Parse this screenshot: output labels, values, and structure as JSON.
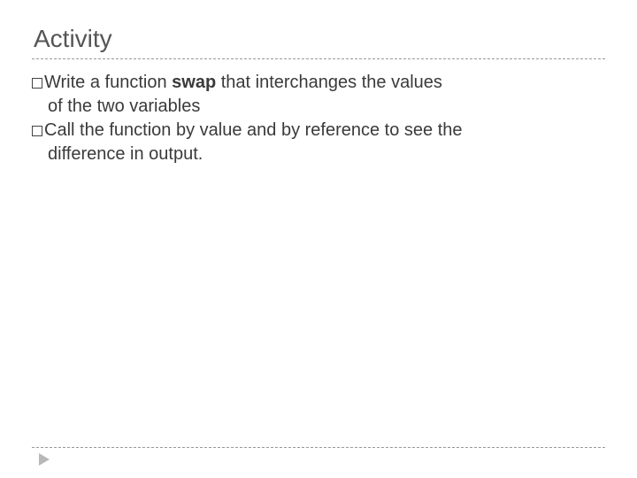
{
  "title": "Activity",
  "bullets": [
    {
      "pre": "Write a function ",
      "bold": "swap",
      "post": " that interchanges the values",
      "cont": "of the two variables"
    },
    {
      "pre": "Call the function by value and by reference to see the",
      "bold": "",
      "post": "",
      "cont": "difference in output."
    }
  ]
}
